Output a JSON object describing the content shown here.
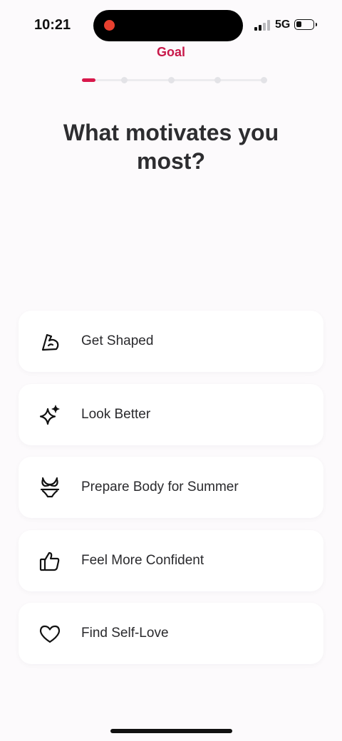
{
  "status_bar": {
    "time": "10:21",
    "network": "5G",
    "battery_level": 0.35,
    "signal_bars_active": 2
  },
  "header": {
    "step_title": "Goal",
    "progress": {
      "current_step": 1,
      "total_steps": 5,
      "accent_color": "#d8184b"
    }
  },
  "question": "What motivates you most?",
  "options": [
    {
      "label": "Get Shaped",
      "icon": "flexed-arm-icon"
    },
    {
      "label": "Look Better",
      "icon": "sparkle-icon"
    },
    {
      "label": "Prepare Body for Summer",
      "icon": "bikini-icon"
    },
    {
      "label": "Feel More Confident",
      "icon": "thumbs-up-icon"
    },
    {
      "label": "Find Self-Love",
      "icon": "heart-icon"
    }
  ]
}
